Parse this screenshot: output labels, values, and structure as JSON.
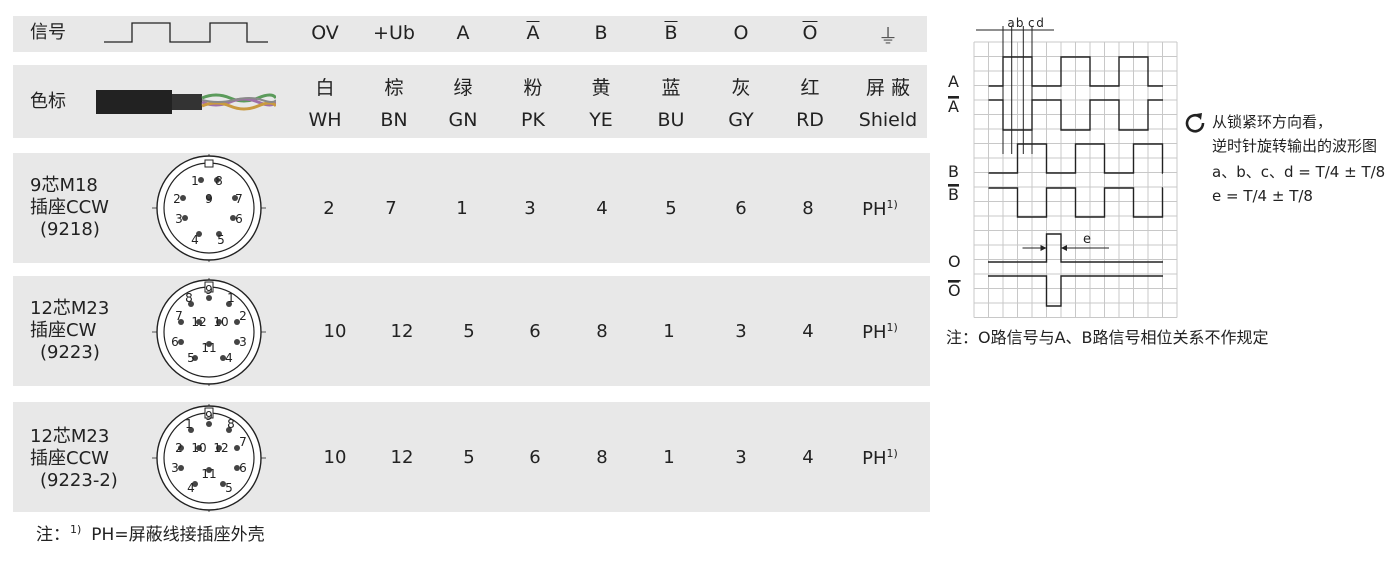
{
  "header": {
    "signal_label": "信号",
    "columns": [
      "OV",
      "+Ub",
      "A",
      "A",
      "B",
      "B",
      "O",
      "O",
      "⏚"
    ],
    "overlined": [
      false,
      false,
      false,
      true,
      false,
      true,
      false,
      true,
      false
    ]
  },
  "color_row": {
    "label": "色标",
    "cn": [
      "白",
      "棕",
      "绿",
      "粉",
      "黄",
      "蓝",
      "灰",
      "红",
      "屏 蔽"
    ],
    "en": [
      "WH",
      "BN",
      "GN",
      "PK",
      "YE",
      "BU",
      "GY",
      "RD",
      "Shield"
    ]
  },
  "rows": [
    {
      "name_line1": "9芯M18",
      "name_line2": "插座CCW",
      "name_line3": "(9218)",
      "values": [
        "2",
        "7",
        "1",
        "3",
        "4",
        "5",
        "6",
        "8",
        "PH"
      ],
      "sup": "1)"
    },
    {
      "name_line1": "12芯M23",
      "name_line2": "插座CW",
      "name_line3": "(9223)",
      "values": [
        "10",
        "12",
        "5",
        "6",
        "8",
        "1",
        "3",
        "4",
        "PH"
      ],
      "sup": "1)"
    },
    {
      "name_line1": "12芯M23",
      "name_line2": "插座CCW",
      "name_line3": "(9223-2)",
      "values": [
        "10",
        "12",
        "5",
        "6",
        "8",
        "1",
        "3",
        "4",
        "PH"
      ],
      "sup": "1)"
    }
  ],
  "connector_pins": {
    "m18": [
      "1",
      "8",
      "2",
      "9",
      "7",
      "3",
      "6",
      "4",
      "5"
    ],
    "m23_cw": [
      "9",
      "8",
      "1",
      "7",
      "12",
      "10",
      "2",
      "6",
      "11",
      "3",
      "5",
      "4"
    ],
    "m23_ccw": [
      "9",
      "1",
      "8",
      "2",
      "10",
      "12",
      "7",
      "3",
      "11",
      "6",
      "4",
      "5"
    ]
  },
  "footnote": {
    "prefix": "注：",
    "sup": "1)",
    "text": "PH=屏蔽线接插座外壳"
  },
  "waveform": {
    "timing_labels": [
      "a",
      "b",
      "c",
      "d"
    ],
    "e_label": "e",
    "signals": [
      "A",
      "A",
      "B",
      "B",
      "O",
      "O"
    ],
    "signal_overlined": [
      false,
      true,
      false,
      true,
      false,
      true
    ]
  },
  "side_notes": {
    "line1": "从锁紧环方向看，",
    "line2": "逆时针旋转输出的波形图",
    "line3": "a、b、c、d = T/4 ± T/8",
    "line4": "e = T/4 ± T/8",
    "bottom": "注：O路信号与A、B路信号相位关系不作规定"
  },
  "colors": {
    "band": "#e8e8e8",
    "grid": "#c8c8c8",
    "line": "#222222"
  }
}
